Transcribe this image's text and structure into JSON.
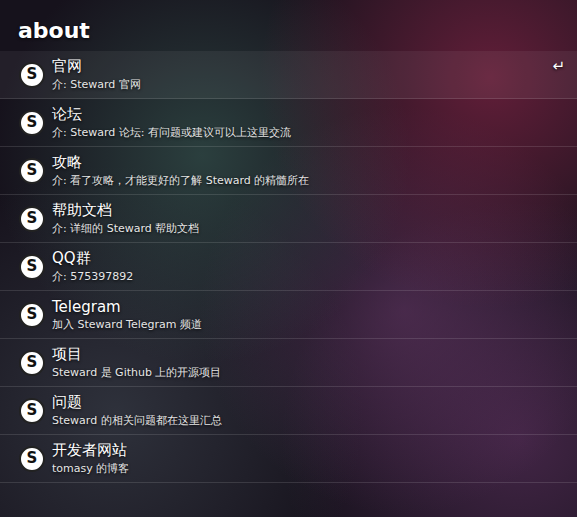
{
  "window": {
    "title": "about"
  },
  "logo": "S",
  "selected_hint": "↵",
  "items": [
    {
      "title": "官网",
      "subtitle": "介: Steward 官网",
      "selected": true
    },
    {
      "title": "论坛",
      "subtitle": "介: Steward 论坛: 有问题或建议可以上这里交流",
      "selected": false
    },
    {
      "title": "攻略",
      "subtitle": "介: 看了攻略，才能更好的了解 Steward 的精髓所在",
      "selected": false
    },
    {
      "title": "帮助文档",
      "subtitle": "介: 详细的 Steward 帮助文档",
      "selected": false
    },
    {
      "title": "QQ群",
      "subtitle": "介: 575397892",
      "selected": false
    },
    {
      "title": "Telegram",
      "subtitle": "加入 Steward Telegram 频道",
      "selected": false
    },
    {
      "title": "项目",
      "subtitle": "Steward 是 Github 上的开源项目",
      "selected": false
    },
    {
      "title": "问题",
      "subtitle": "Steward 的相关问题都在这里汇总",
      "selected": false
    },
    {
      "title": "开发者网站",
      "subtitle": "tomasy 的博客",
      "selected": false
    }
  ]
}
